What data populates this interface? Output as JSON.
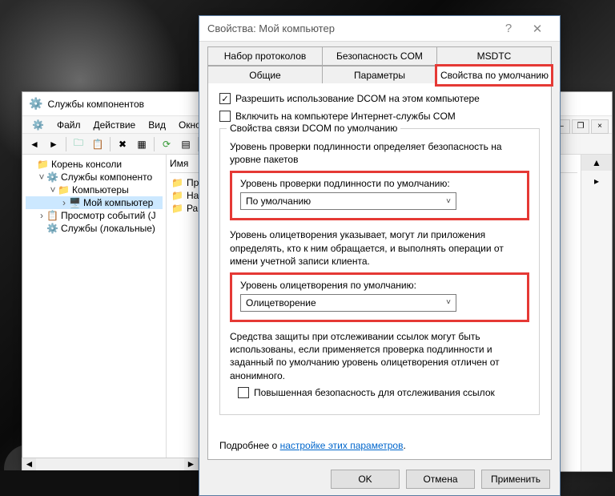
{
  "mmc": {
    "title": "Службы компонентов",
    "menu": {
      "file": "Файл",
      "action": "Действие",
      "view": "Вид",
      "window": "Окно"
    },
    "tree": {
      "root": "Корень консоли",
      "comp_services": "Службы компоненто",
      "computers": "Компьютеры",
      "my_computer": "Мой компьютер",
      "event_viewer": "Просмотр событий (J",
      "local_services": "Службы (локальные)"
    },
    "list": {
      "header": "Имя",
      "r1": "Пр",
      "r2": "На",
      "r3": "Ра:"
    }
  },
  "dialog": {
    "title": "Свойства: Мой компьютер",
    "tabs": {
      "protocols": "Набор протоколов",
      "com_security": "Безопасность COM",
      "msdtc": "MSDTC",
      "general": "Общие",
      "options": "Параметры",
      "default_props": "Свойства по умолчанию"
    },
    "enable_dcom": "Разрешить использование DCOM на этом компьютере",
    "enable_com_inet": "Включить на компьютере Интернет-службы COM",
    "group_legend": "Свойства связи DCOM по умолчанию",
    "auth_desc": "Уровень проверки подлинности определяет безопасность на уровне пакетов",
    "auth_label": "Уровень проверки подлинности по умолчанию:",
    "auth_value": "По умолчанию",
    "impers_desc": "Уровень олицетворения указывает, могут ли приложения определять, кто к ним обращается, и выполнять операции от имени учетной записи клиента.",
    "impers_label": "Уровень олицетворения по умолчанию:",
    "impers_value": "Олицетворение",
    "tracking_desc": "Средства защиты при отслеживании ссылок могут быть использованы, если применяется проверка подлинности и заданный по умолчанию уровень олицетворения отличен от анонимного.",
    "tracking_check": "Повышенная безопасность для отслеживания ссылок",
    "more_prefix": "Подробнее о ",
    "more_link": "настройке этих параметров",
    "btn_ok": "OK",
    "btn_cancel": "Отмена",
    "btn_apply": "Применить"
  }
}
